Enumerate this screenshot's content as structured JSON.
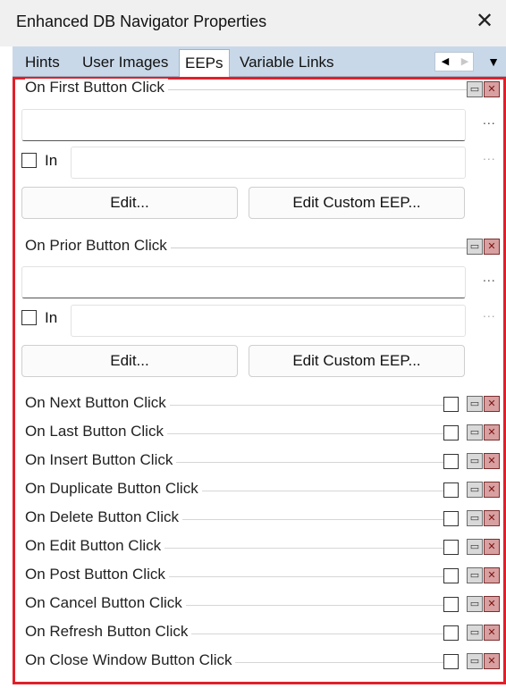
{
  "window": {
    "title": "Enhanced DB Navigator Properties",
    "close_glyph": "✕"
  },
  "tabs": [
    {
      "label": "Hints",
      "active": false
    },
    {
      "label": "User Images",
      "active": false
    },
    {
      "label": "EEPs",
      "active": true
    },
    {
      "label": "Variable Links",
      "active": false
    }
  ],
  "tab_scroll": {
    "left_glyph": "◀",
    "right_glyph": "▶",
    "menu_glyph": "▼"
  },
  "expanded_groups": [
    {
      "label": "On First Button Click",
      "value": "",
      "in_label": "In",
      "in_checked": false,
      "in_value": "",
      "ellipsis": "...",
      "edit_label": "Edit...",
      "edit_custom_label": "Edit Custom EEP..."
    },
    {
      "label": "On Prior Button Click",
      "value": "",
      "in_label": "In",
      "in_checked": false,
      "in_value": "",
      "ellipsis": "...",
      "edit_label": "Edit...",
      "edit_custom_label": "Edit Custom EEP..."
    }
  ],
  "collapsed_events": [
    {
      "label": "On Next Button Click"
    },
    {
      "label": "On Last Button Click"
    },
    {
      "label": "On Insert Button Click"
    },
    {
      "label": "On Duplicate Button Click"
    },
    {
      "label": "On Delete Button Click"
    },
    {
      "label": "On Edit Button Click"
    },
    {
      "label": "On Post Button Click"
    },
    {
      "label": "On Cancel Button Click"
    },
    {
      "label": "On Refresh Button Click"
    },
    {
      "label": "On Close Window Button Click"
    }
  ],
  "icons": {
    "collapse": "collapse-icon",
    "delete": "delete-x-icon"
  },
  "colors": {
    "highlight_border": "#e0202a",
    "tabbar_bg": "#c8d8e8"
  }
}
